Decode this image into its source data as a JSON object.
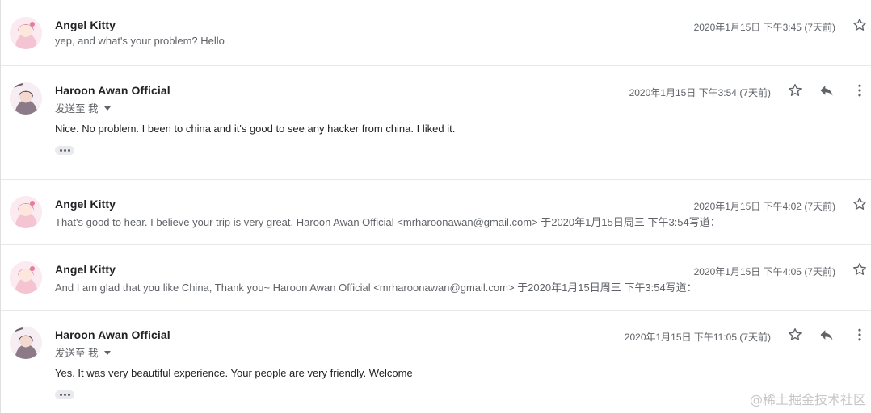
{
  "messages": [
    {
      "sender": "Angel Kitty",
      "snippet": "yep, and what's your problem? Hello",
      "date": "2020年1月15日 下午3:45 (7天前)"
    },
    {
      "sender": "Haroon Awan Official",
      "sent_to": "发送至 我",
      "date": "2020年1月15日 下午3:54 (7天前)",
      "body": "Nice. No problem. I been to china and it's good to see any hacker from china. I liked it."
    },
    {
      "sender": "Angel Kitty",
      "snippet": "That's good to hear. I believe your trip is very great. Haroon Awan Official <mrharoonawan@gmail.com> 于2020年1月15日周三 下午3:54写道：",
      "date": "2020年1月15日 下午4:02 (7天前)"
    },
    {
      "sender": "Angel Kitty",
      "snippet": "And I am glad that you like China, Thank you~ Haroon Awan Official <mrharoonawan@gmail.com> 于2020年1月15日周三 下午3:54写道：",
      "date": "2020年1月15日 下午4:05 (7天前)"
    },
    {
      "sender": "Haroon Awan Official",
      "sent_to": "发送至 我",
      "date": "2020年1月15日 下午11:05 (7天前)",
      "body": "Yes. It was very beautiful experience. Your people are very friendly. Welcome"
    }
  ],
  "watermark": "@稀土掘金技术社区",
  "icons": {
    "star": "star-icon",
    "reply": "reply-icon",
    "more": "more-vert-icon",
    "expand": "more-horiz-icon",
    "caret": "caret-down-icon"
  },
  "colors": {
    "text_primary": "#202124",
    "text_secondary": "#5f6368",
    "divider": "#e8e8e8"
  }
}
